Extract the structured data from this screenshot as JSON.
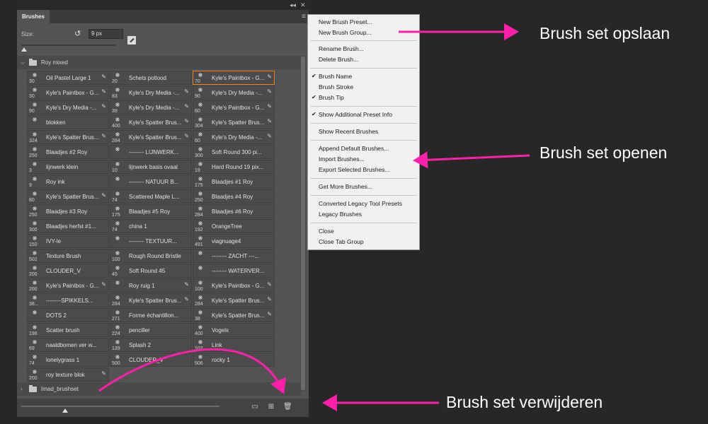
{
  "panel": {
    "tab_label": "Brushes",
    "collapse_glyph": "◂◂",
    "close_glyph": "✕",
    "menu_glyph": "≡",
    "size_label": "Size:",
    "size_value": "9 px",
    "group1_name": "Roy mixed",
    "group2_name": "Imad_brushset"
  },
  "brushes": [
    {
      "num": "30",
      "name": "Oil Pastel Large 1",
      "edit": true
    },
    {
      "num": "20",
      "name": "Schets potlood",
      "edit": false
    },
    {
      "num": "70",
      "name": "Kyle's Paintbox - G...",
      "edit": true,
      "selected": true
    },
    {
      "num": "30",
      "name": "Kyle's Paintbox - G...",
      "edit": true
    },
    {
      "num": "83",
      "name": "Kyle's Dry Media -...",
      "edit": true
    },
    {
      "num": "90",
      "name": "Kyle's Dry Media -...",
      "edit": true
    },
    {
      "num": "90",
      "name": "Kyle's Dry Media -...",
      "edit": true
    },
    {
      "num": "39",
      "name": "Kyle's Dry Media -...",
      "edit": true
    },
    {
      "num": "60",
      "name": "Kyle's Paintbox - G...",
      "edit": true
    },
    {
      "num": "",
      "name": "blokken",
      "edit": false
    },
    {
      "num": "400",
      "name": "Kyle's Spatter Brus...",
      "edit": true
    },
    {
      "num": "304",
      "name": "Kyle's Spatter Brus...",
      "edit": true
    },
    {
      "num": "324",
      "name": "Kyle's Spatter Brus...",
      "edit": true
    },
    {
      "num": "284",
      "name": "Kyle's Spatter Brus...",
      "edit": true
    },
    {
      "num": "60",
      "name": "Kyle's Dry Media -...",
      "edit": true
    },
    {
      "num": "250",
      "name": "Blaadjes #2 Roy",
      "edit": false
    },
    {
      "num": "",
      "name": "-------- LIJNWERK...",
      "edit": false
    },
    {
      "num": "300",
      "name": "Soft Round 300 pi...",
      "edit": false
    },
    {
      "num": "3",
      "name": "lijnwerk klein",
      "edit": false
    },
    {
      "num": "10",
      "name": "lijnwerk basis ovaal",
      "edit": false
    },
    {
      "num": "19",
      "name": "Hard Round 19 pix...",
      "edit": false
    },
    {
      "num": "9",
      "name": "Roy ink",
      "edit": false
    },
    {
      "num": "",
      "name": "-------- NATUUR B...",
      "edit": false
    },
    {
      "num": "175",
      "name": "Blaadjes #1 Roy",
      "edit": false
    },
    {
      "num": "80",
      "name": "Kyle's Spatter Brus...",
      "edit": true
    },
    {
      "num": "74",
      "name": "Scattered Maple L...",
      "edit": false
    },
    {
      "num": "250",
      "name": "Blaadjes #4 Roy",
      "edit": false
    },
    {
      "num": "250",
      "name": "Blaadjes #3 Roy",
      "edit": false
    },
    {
      "num": "175",
      "name": "Blaadjes #5 Roy",
      "edit": false
    },
    {
      "num": "284",
      "name": "Blaadjes #6 Roy",
      "edit": false
    },
    {
      "num": "300",
      "name": "Blaadjes herfst #1...",
      "edit": false
    },
    {
      "num": "74",
      "name": "china 1",
      "edit": false
    },
    {
      "num": "192",
      "name": "OrangeTree",
      "edit": false
    },
    {
      "num": "150",
      "name": "IVY-le",
      "edit": false
    },
    {
      "num": "",
      "name": "-------- TEXTUUR...",
      "edit": false
    },
    {
      "num": "491",
      "name": "viagnuage4",
      "edit": false
    },
    {
      "num": "502",
      "name": "Texture Brush",
      "edit": false
    },
    {
      "num": "100",
      "name": "Rough Round Bristle",
      "edit": false
    },
    {
      "num": "",
      "name": "-------- ZACHT ---...",
      "edit": false
    },
    {
      "num": "200",
      "name": "CLOUDER_V",
      "edit": false
    },
    {
      "num": "45",
      "name": "Soft Round 45",
      "edit": false
    },
    {
      "num": "",
      "name": "-------- WATERVER...",
      "edit": false
    },
    {
      "num": "200",
      "name": "Kyle's Paintbox - G...",
      "edit": true
    },
    {
      "num": "",
      "name": "Roy ruig 1",
      "edit": true
    },
    {
      "num": "100",
      "name": "Kyle's Paintbox - G...",
      "edit": true
    },
    {
      "num": "38...",
      "name": "--------SPIKKELS...",
      "edit": false
    },
    {
      "num": "284",
      "name": "Kyle's Spatter Brus...",
      "edit": true
    },
    {
      "num": "284",
      "name": "Kyle's Spatter Brus...",
      "edit": true
    },
    {
      "num": "",
      "name": "DOTS 2",
      "edit": false
    },
    {
      "num": "271",
      "name": "Forme échantillon...",
      "edit": false
    },
    {
      "num": "38",
      "name": "Kyle's Spatter Brus...",
      "edit": true
    },
    {
      "num": "196",
      "name": "Scatter brush",
      "edit": false
    },
    {
      "num": "224",
      "name": "penciller",
      "edit": false
    },
    {
      "num": "400",
      "name": "Vogels",
      "edit": false
    },
    {
      "num": "69",
      "name": "naaldbomen ver w...",
      "edit": false
    },
    {
      "num": "139",
      "name": "Splash 2",
      "edit": false
    },
    {
      "num": "102",
      "name": "Link",
      "edit": false
    },
    {
      "num": "74",
      "name": "lonelygrass 1",
      "edit": false
    },
    {
      "num": "500",
      "name": "CLOUDER_V",
      "edit": false
    },
    {
      "num": "506",
      "name": "rocky 1",
      "edit": false
    },
    {
      "num": "200",
      "name": "roy texture blok",
      "edit": true
    }
  ],
  "menu": [
    {
      "label": "New Brush Preset...",
      "checked": false
    },
    {
      "label": "New Brush Group...",
      "checked": false
    },
    {
      "label": "Rename Brush...",
      "checked": false
    },
    {
      "label": "Delete Brush...",
      "checked": false
    },
    {
      "label": "Brush Name",
      "checked": true
    },
    {
      "label": "Brush Stroke",
      "checked": false
    },
    {
      "label": "Brush Tip",
      "checked": true
    },
    {
      "label": "Show Additional Preset Info",
      "checked": true
    },
    {
      "label": "Show Recent Brushes",
      "checked": false
    },
    {
      "label": "Append Default Brushes...",
      "checked": false
    },
    {
      "label": "Import Brushes...",
      "checked": false
    },
    {
      "label": "Export Selected Brushes...",
      "checked": false
    },
    {
      "label": "Get More Brushes...",
      "checked": false
    },
    {
      "label": "Converted Legacy Tool Presets",
      "checked": false
    },
    {
      "label": "Legacy Brushes",
      "checked": false
    },
    {
      "label": "Close",
      "checked": false
    },
    {
      "label": "Close Tab Group",
      "checked": false
    }
  ],
  "annotations": {
    "save": "Brush set opslaan",
    "open": "Brush set openen",
    "delete": "Brush set verwijderen",
    "color": "#ff1fa8"
  }
}
